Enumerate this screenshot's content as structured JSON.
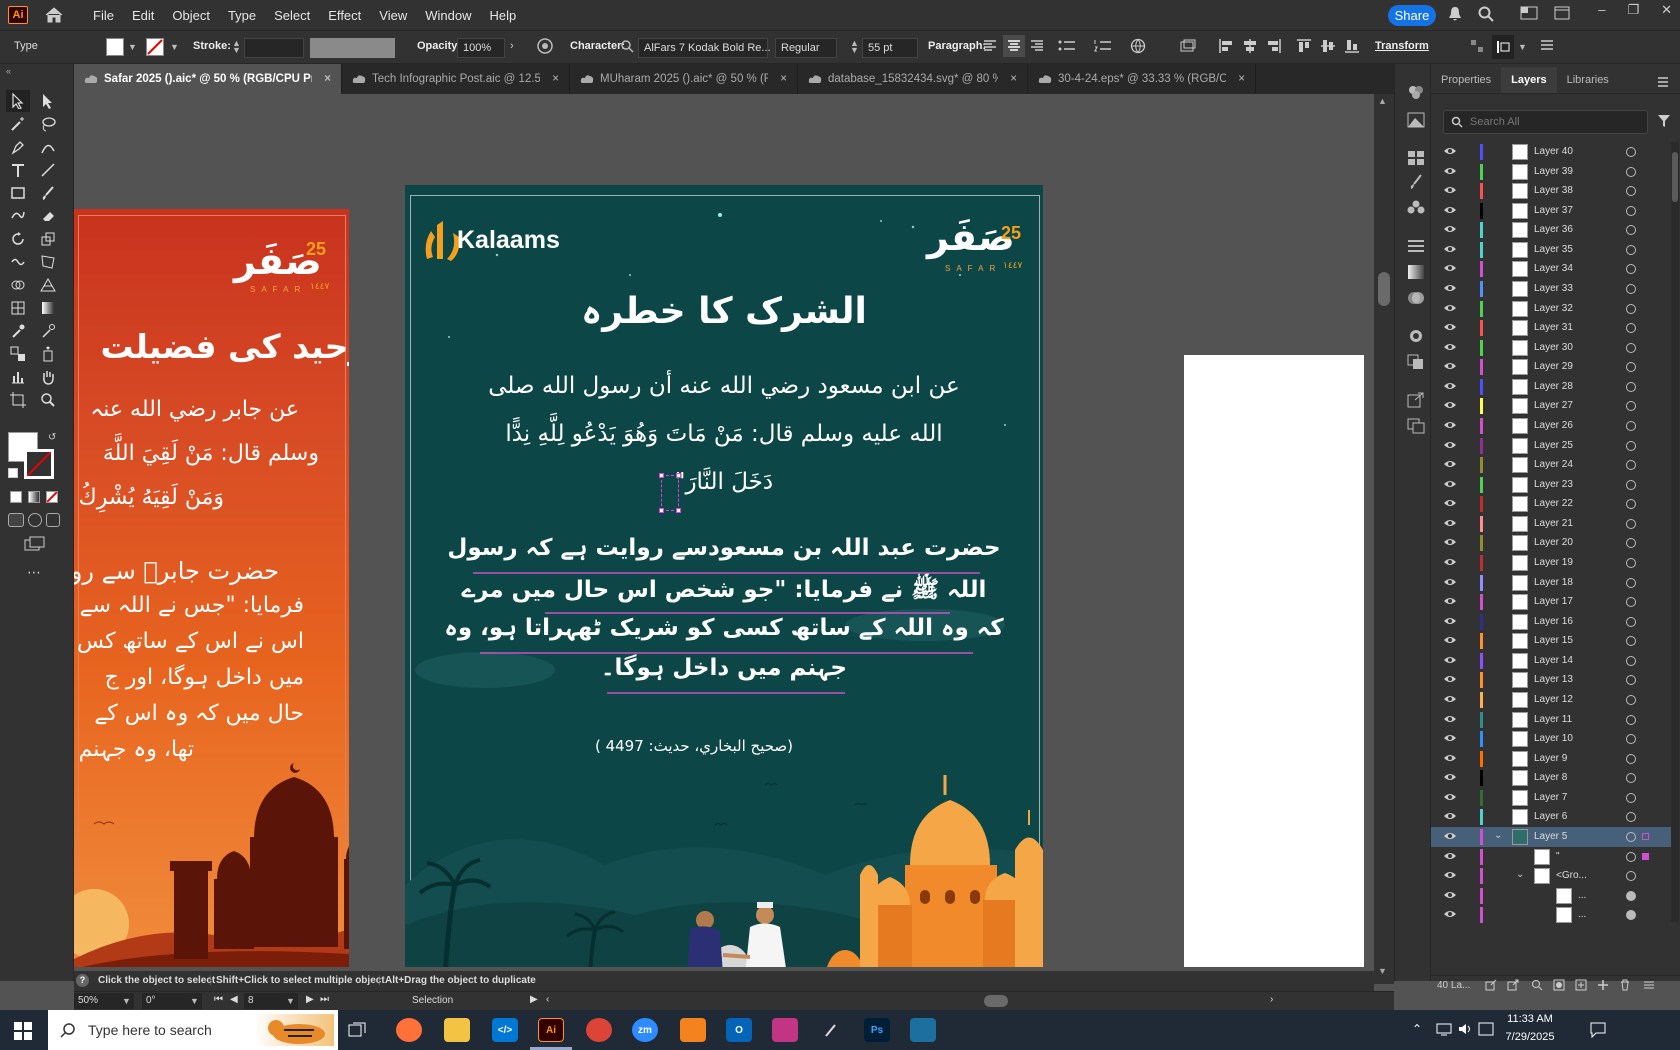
{
  "menubar": {
    "items": [
      "File",
      "Edit",
      "Object",
      "Type",
      "Select",
      "Effect",
      "View",
      "Window",
      "Help"
    ],
    "share_label": "Share",
    "app_badge": "Ai"
  },
  "controlbar": {
    "tool": "Type",
    "stroke_label": "Stroke:",
    "opacity_label": "Opacity:",
    "opacity_value": "100%",
    "character_label": "Character:",
    "font_name": "AlFars 7 Kodak Bold Re...",
    "font_style": "Regular",
    "font_size": "55 pt",
    "paragraph_label": "Paragraph:",
    "transform_label": "Transform"
  },
  "tabs": [
    {
      "label": "Safar 2025 ().aic* @ 50 % (RGB/CPU Preview)",
      "active": true
    },
    {
      "label": "Tech Infographic Post.aic @ 12.5 ...",
      "active": false
    },
    {
      "label": "MUharam 2025 ().aic* @ 50 % (RG...",
      "active": false
    },
    {
      "label": "database_15832434.svg* @ 80 % (RGB/...",
      "active": false
    },
    {
      "label": "30-4-24.eps* @ 33.33 % (RGB/CPU Pre...",
      "active": false
    }
  ],
  "panel": {
    "tabs": [
      "Properties",
      "Layers",
      "Libraries"
    ],
    "active_tab": "Layers",
    "search_placeholder": "Search All",
    "layer_count": "40 La..."
  },
  "layers": [
    {
      "name": "Layer 40",
      "color": "#4f4fff"
    },
    {
      "name": "Layer 39",
      "color": "#4fd24f"
    },
    {
      "name": "Layer 38",
      "color": "#ff4f4f"
    },
    {
      "name": "Layer 37",
      "color": "#000000"
    },
    {
      "name": "Layer 36",
      "color": "#4fd2d2"
    },
    {
      "name": "Layer 35",
      "color": "#4fd2d2"
    },
    {
      "name": "Layer 34",
      "color": "#d24fd2"
    },
    {
      "name": "Layer 33",
      "color": "#4f8fff"
    },
    {
      "name": "Layer 32",
      "color": "#4fd24f"
    },
    {
      "name": "Layer 31",
      "color": "#ff4f4f"
    },
    {
      "name": "Layer 30",
      "color": "#4fd24f"
    },
    {
      "name": "Layer 29",
      "color": "#d24fd2"
    },
    {
      "name": "Layer 28",
      "color": "#4f4fff"
    },
    {
      "name": "Layer 27",
      "color": "#ffff4f"
    },
    {
      "name": "Layer 26",
      "color": "#d24fd2"
    },
    {
      "name": "Layer 25",
      "color": "#8f2f8f"
    },
    {
      "name": "Layer 24",
      "color": "#8f8f2f"
    },
    {
      "name": "Layer 23",
      "color": "#4fd24f"
    },
    {
      "name": "Layer 22",
      "color": "#c02f2f"
    },
    {
      "name": "Layer 21",
      "color": "#ff8f8f"
    },
    {
      "name": "Layer 20",
      "color": "#8f8f2f"
    },
    {
      "name": "Layer 19",
      "color": "#c02f2f"
    },
    {
      "name": "Layer 18",
      "color": "#8f8fff"
    },
    {
      "name": "Layer 17",
      "color": "#d24fd2"
    },
    {
      "name": "Layer 16",
      "color": "#2f2f8f"
    },
    {
      "name": "Layer 15",
      "color": "#ff8f2f"
    },
    {
      "name": "Layer 14",
      "color": "#8f4fff"
    },
    {
      "name": "Layer 13",
      "color": "#ff8f2f"
    },
    {
      "name": "Layer 12",
      "color": "#ffaf4f"
    },
    {
      "name": "Layer 11",
      "color": "#2f8f8f"
    },
    {
      "name": "Layer 10",
      "color": "#2f8fff"
    },
    {
      "name": "Layer 9",
      "color": "#ff6f00"
    },
    {
      "name": "Layer 8",
      "color": "#000000"
    },
    {
      "name": "Layer 7",
      "color": "#2f6f2f"
    },
    {
      "name": "Layer 6",
      "color": "#4fd2d2"
    },
    {
      "name": "Layer 5",
      "color": "#d24fd2",
      "expanded": true,
      "selected": true
    },
    {
      "name": "\"",
      "color": "#d24fd2",
      "sub": 1
    },
    {
      "name": "<Gro...",
      "color": "#d24fd2",
      "sub": 1,
      "expanded": true
    },
    {
      "name": "...",
      "color": "#d24fd2",
      "sub": 2
    },
    {
      "name": "...",
      "color": "#d24fd2",
      "sub": 2
    }
  ],
  "status": {
    "hint_1": "Click the object to select",
    "hint_2": "Shift+Click to select multiple object",
    "hint_3": "Alt+Drag the object to duplicate",
    "zoom": "50%",
    "rotation": "0°",
    "artboard_num": "8",
    "tool_name": "Selection"
  },
  "art_main": {
    "brand": "Kalaams",
    "safar_ar": "صَفَر",
    "safar_num": "25",
    "safar_en": "SAFAR",
    "safar_year": "١٤٤٧",
    "title": "الشرک کا خطرہ",
    "hadith_ar_1": "عن ابن مسعود رضي الله عنه أن رسول الله صلى",
    "hadith_ar_2": "الله عليه وسلم قال: مَنْ مَاتَ وَهُوَ يَدْعُو لِلَّهِ نِدًّا",
    "hadith_ar_3": "دَخَلَ النَّارَ\"",
    "urdu_1": "حضرت عبد اللہ بن مسعودسے روایت ہے کہ رسول",
    "urdu_2": "اللہ ﷺ نے فرمایا: \"جو شخص اس حال میں مرے",
    "urdu_3": "کہ وہ اللہ کے ساتھ کسی کو شریک ٹھہراتا ہو، وہ",
    "urdu_4": "جہنم میں داخل ہوگا۔",
    "source": "(صحيح البخاري، حديث: 4497 )"
  },
  "art_left": {
    "safar_ar": "صَفَر",
    "safar_num": "25",
    "safar_en": "SAFAR",
    "safar_year": "١٤٤٧",
    "title": "توحید کی فضیلت",
    "ar_1": "عن جابر رضي الله عنہ",
    "ar_2": "وسلم قال: مَنْ لَقِيَ اللَّهَ",
    "ar_3": "وَمَنْ لَقِيَهُ يُشْرِكُ",
    "ur_1": "حضرت جابرؓ سے رو",
    "ur_2": "فرمایا: \"جس نے اللہ سے",
    "ur_3": "اس نے اس کے ساتھ کس",
    "ur_4": "میں داخل ہوگا، اور ج",
    "ur_5": "حال میں کہ وہ اس کے",
    "ur_6": "تھا، وہ جہنم"
  },
  "taskbar": {
    "search_placeholder": "Type here to search",
    "time": "11:33 AM",
    "date": "7/29/2025"
  },
  "colors": {
    "accent": "#1473e6",
    "art_teal": "#0d4647",
    "art_orange": "#e7641f"
  }
}
